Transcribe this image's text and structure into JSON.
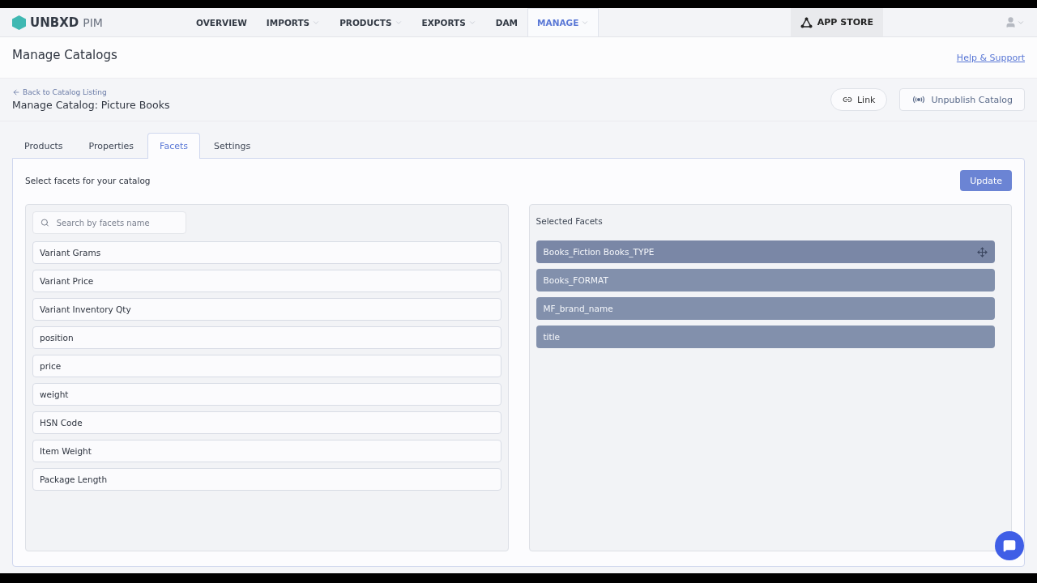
{
  "brand": {
    "name": "UNBXD",
    "suffix": "PIM"
  },
  "nav": [
    {
      "label": "OVERVIEW",
      "has_menu": false,
      "selected": false
    },
    {
      "label": "IMPORTS",
      "has_menu": true,
      "selected": false
    },
    {
      "label": "PRODUCTS",
      "has_menu": true,
      "selected": false
    },
    {
      "label": "EXPORTS",
      "has_menu": true,
      "selected": false
    },
    {
      "label": "DAM",
      "has_menu": false,
      "selected": false
    },
    {
      "label": "MANAGE",
      "has_menu": true,
      "selected": true
    }
  ],
  "app_store": "APP STORE",
  "page_title": "Manage Catalogs",
  "help_link": "Help & Support",
  "back_link": "Back to Catalog Listing",
  "catalog_title": "Manage Catalog: Picture Books",
  "actions": {
    "link": "Link",
    "unpublish": "Unpublish Catalog"
  },
  "tabs": [
    {
      "label": "Products",
      "selected": false
    },
    {
      "label": "Properties",
      "selected": false
    },
    {
      "label": "Facets",
      "selected": true
    },
    {
      "label": "Settings",
      "selected": false
    }
  ],
  "instruction": "Select facets for your catalog",
  "update_button": "Update",
  "search": {
    "placeholder": "Search by facets name"
  },
  "available_facets": [
    "Variant Grams",
    "Variant Price",
    "Variant Inventory Qty",
    "position",
    "price",
    "weight",
    "HSN Code",
    "Item Weight",
    "Package Length"
  ],
  "selected_title": "Selected Facets",
  "selected_facets": [
    {
      "label": "Books_Fiction Books_TYPE",
      "hovered": true
    },
    {
      "label": "Books_FORMAT",
      "hovered": false
    },
    {
      "label": "MF_brand_name",
      "hovered": false
    },
    {
      "label": "title",
      "hovered": false
    }
  ]
}
